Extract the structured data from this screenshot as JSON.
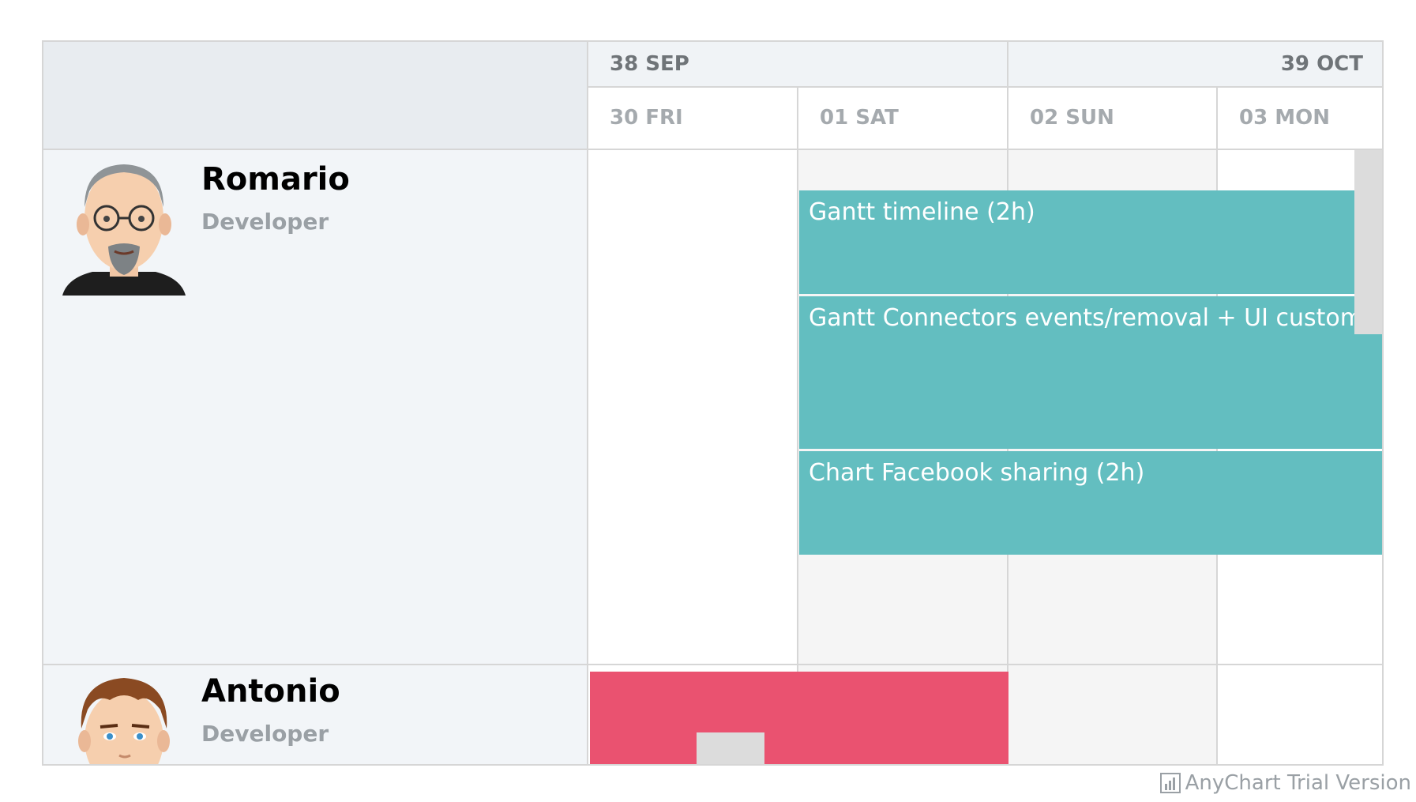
{
  "header": {
    "weeks": [
      {
        "label": "38 SEP"
      },
      {
        "label": "39 OCT"
      }
    ],
    "days": [
      {
        "label": "30 FRI"
      },
      {
        "label": "01 SAT"
      },
      {
        "label": "02 SUN"
      },
      {
        "label": "03 MON"
      }
    ]
  },
  "resources": [
    {
      "name": "Romario",
      "role": "Developer",
      "tasks": [
        {
          "label": "Gantt timeline (2h)",
          "color": "#63bec0"
        },
        {
          "label": "Gantt Connectors events/removal + UI customiz",
          "color": "#63bec0"
        },
        {
          "label": "Chart Facebook sharing (2h)",
          "color": "#63bec0"
        }
      ]
    },
    {
      "name": "Antonio",
      "role": "Developer",
      "tasks": [
        {
          "label": "",
          "color": "#ea5270"
        }
      ]
    }
  ],
  "credits": {
    "text": "AnyChart Trial Version",
    "icon": "chart-bars-icon"
  }
}
